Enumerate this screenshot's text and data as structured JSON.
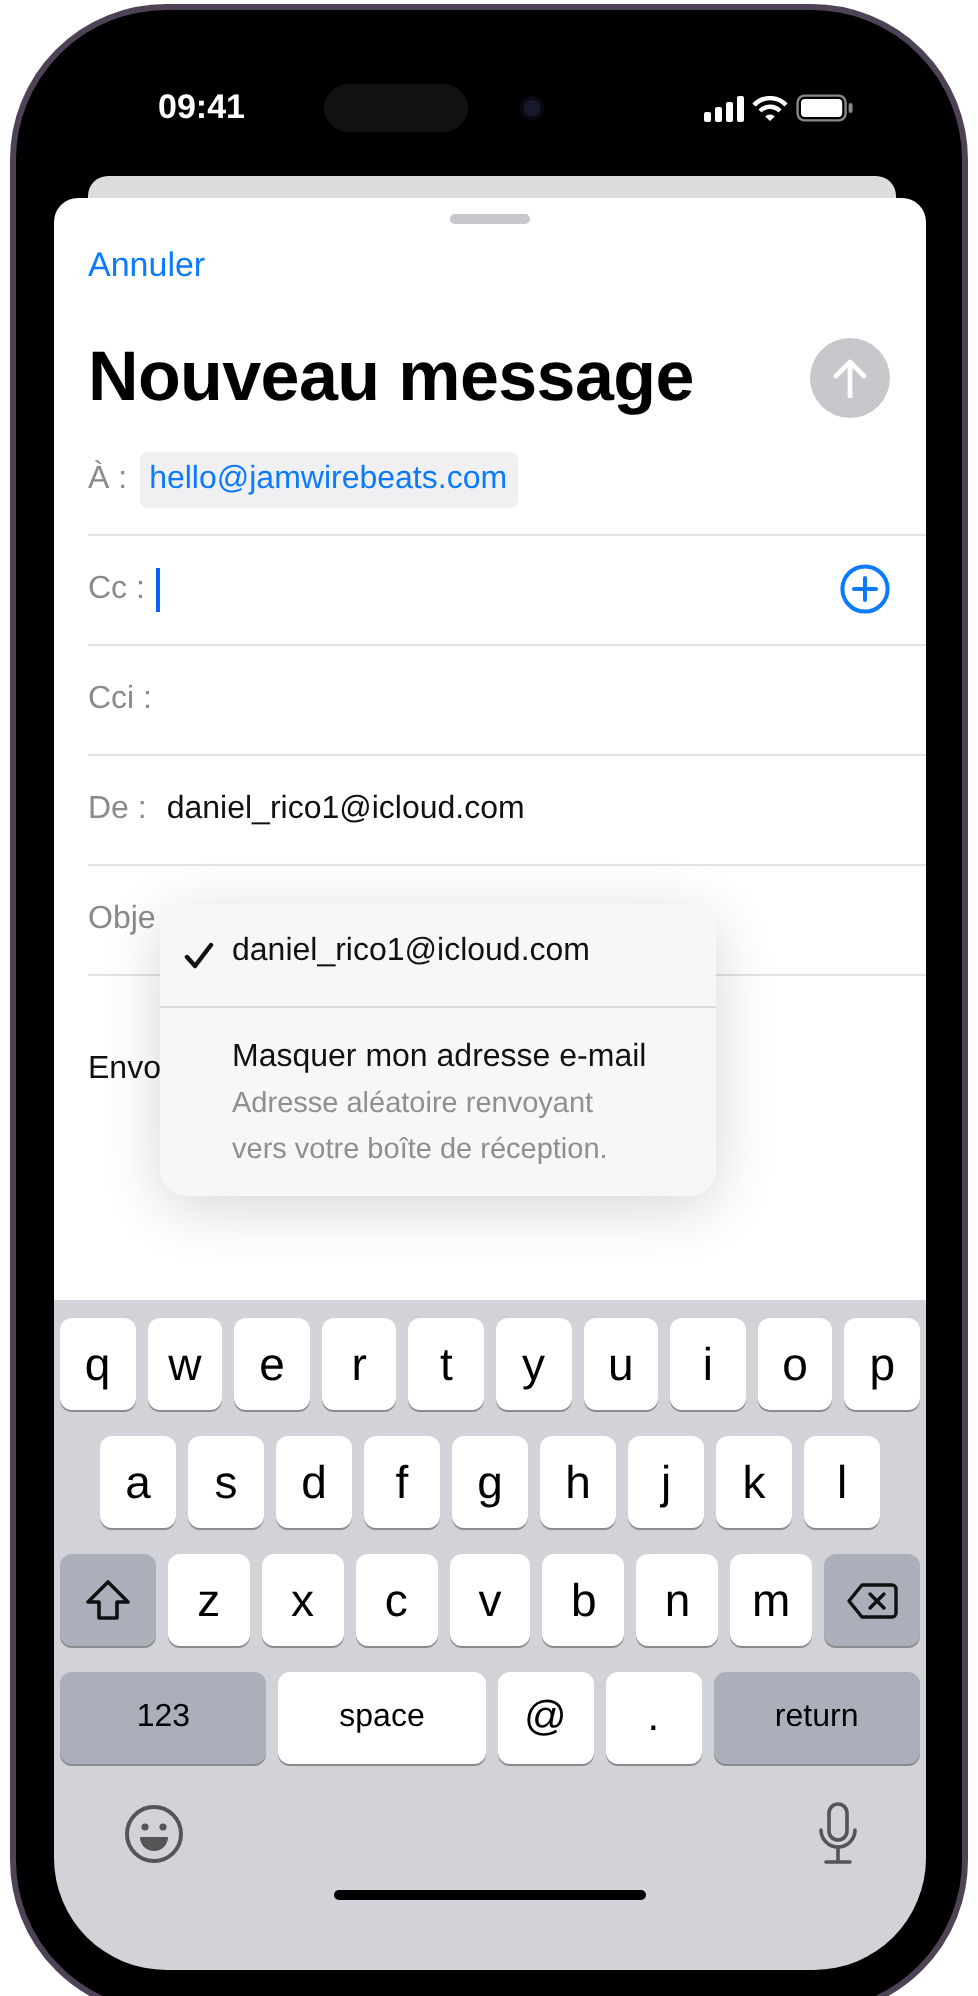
{
  "status_bar": {
    "time": "09:41"
  },
  "compose": {
    "cancel": "Annuler",
    "title": "Nouveau message",
    "send_disabled": true
  },
  "fields": [
    {
      "kind": "recipient",
      "label": "À :",
      "value": "hello@jamwirebeats.com"
    },
    {
      "kind": "focused",
      "label": "Cc :"
    },
    {
      "kind": "empty",
      "label": "Cci :"
    },
    {
      "kind": "text",
      "label": "De :",
      "value": "daniel_rico1@icloud.com"
    },
    {
      "kind": "empty",
      "label": "Obje"
    }
  ],
  "body": {
    "text": "Envo"
  },
  "from_menu": {
    "items": [
      {
        "title": "daniel_rico1@icloud.com",
        "selected": true
      },
      {
        "title": "Masquer mon adresse e-mail",
        "subtitle": "Adresse aléatoire renvoyant vers votre boîte de réception.",
        "selected": false
      }
    ]
  },
  "keyboard": {
    "rows": [
      [
        {
          "kind": "char",
          "label": "q"
        },
        {
          "kind": "char",
          "label": "w"
        },
        {
          "kind": "char",
          "label": "e"
        },
        {
          "kind": "char",
          "label": "r"
        },
        {
          "kind": "char",
          "label": "t"
        },
        {
          "kind": "char",
          "label": "y"
        },
        {
          "kind": "char",
          "label": "u"
        },
        {
          "kind": "char",
          "label": "i"
        },
        {
          "kind": "char",
          "label": "o"
        },
        {
          "kind": "char",
          "label": "p"
        }
      ],
      [
        {
          "kind": "char",
          "label": "a"
        },
        {
          "kind": "char",
          "label": "s"
        },
        {
          "kind": "char",
          "label": "d"
        },
        {
          "kind": "char",
          "label": "f"
        },
        {
          "kind": "char",
          "label": "g"
        },
        {
          "kind": "char",
          "label": "h"
        },
        {
          "kind": "char",
          "label": "j"
        },
        {
          "kind": "char",
          "label": "k"
        },
        {
          "kind": "char",
          "label": "l"
        }
      ],
      [
        {
          "kind": "shift"
        },
        {
          "kind": "char",
          "label": "z"
        },
        {
          "kind": "char",
          "label": "x"
        },
        {
          "kind": "char",
          "label": "c"
        },
        {
          "kind": "char",
          "label": "v"
        },
        {
          "kind": "char",
          "label": "b"
        },
        {
          "kind": "char",
          "label": "n"
        },
        {
          "kind": "char",
          "label": "m"
        },
        {
          "kind": "delete"
        }
      ]
    ],
    "bottom_row": [
      {
        "kind": "mode",
        "label": "123"
      },
      {
        "kind": "space",
        "label": "space"
      },
      {
        "kind": "symbol",
        "label": "@"
      },
      {
        "kind": "symbol",
        "label": "."
      },
      {
        "kind": "mode",
        "label": "return"
      }
    ]
  }
}
